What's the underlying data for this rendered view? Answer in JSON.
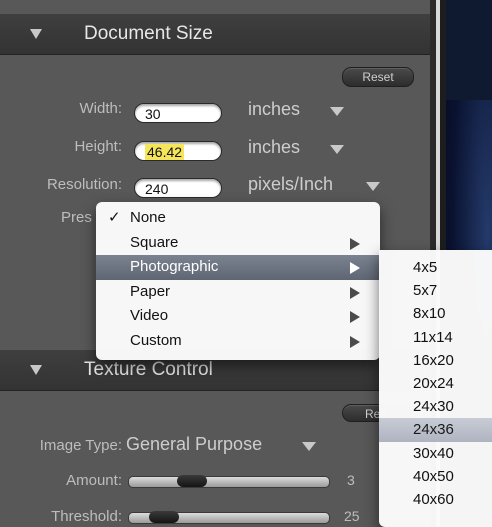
{
  "document_size": {
    "title": "Document Size",
    "reset_label": "Reset",
    "width": {
      "label": "Width:",
      "value": "30",
      "unit": "inches"
    },
    "height": {
      "label": "Height:",
      "value": "46.42",
      "unit": "inches"
    },
    "resolution": {
      "label": "Resolution:",
      "value": "240",
      "unit": "pixels/Inch"
    },
    "preset_label_visible": "Pres"
  },
  "preset_menu": {
    "items": [
      {
        "label": "None",
        "checked": true,
        "has_submenu": false
      },
      {
        "label": "Square",
        "checked": false,
        "has_submenu": true
      },
      {
        "label": "Photographic",
        "checked": false,
        "has_submenu": true,
        "active": true
      },
      {
        "label": "Paper",
        "checked": false,
        "has_submenu": true
      },
      {
        "label": "Video",
        "checked": false,
        "has_submenu": true
      },
      {
        "label": "Custom",
        "checked": false,
        "has_submenu": true
      }
    ],
    "check_glyph": "✓"
  },
  "photographic_submenu": {
    "items": [
      "4x5",
      "5x7",
      "8x10",
      "11x14",
      "16x20",
      "20x24",
      "24x30",
      "24x36",
      "30x40",
      "40x50",
      "40x60"
    ],
    "active_index": 7
  },
  "texture_control": {
    "title": "Texture Control",
    "reset_label_visible": "Res",
    "image_type": {
      "label": "Image Type:",
      "value": "General Purpose"
    },
    "amount": {
      "label": "Amount:",
      "value": "3",
      "fraction": 0.28
    },
    "threshold": {
      "label": "Threshold:",
      "value": "25",
      "fraction": 0.12
    }
  },
  "icons": {
    "section_toggle": "disclosure-triangle-icon",
    "dropdown": "dropdown-arrow-icon",
    "submenu": "submenu-arrow-icon",
    "check": "checkmark-icon"
  },
  "colors": {
    "panel_bg": "#585858",
    "header_bg": "#383838",
    "menu_highlight": "#6b7280",
    "submenu_highlight": "#b8bec9",
    "height_highlight": "#f4e55b"
  }
}
